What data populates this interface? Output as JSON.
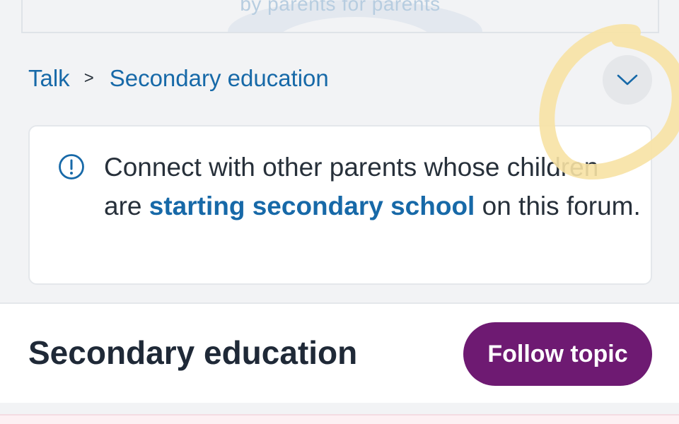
{
  "banner": {
    "tagline": "by parents for parents"
  },
  "breadcrumb": {
    "items": [
      {
        "label": "Talk"
      },
      {
        "label": "Secondary education"
      }
    ],
    "separator": ">"
  },
  "expand_button": {
    "icon": "chevron-down-icon"
  },
  "info": {
    "icon": "info-circle-icon",
    "text_before": "Connect with other parents whose children are ",
    "link_text": "starting secondary school",
    "text_after": " on this forum."
  },
  "topic": {
    "title": "Secondary education",
    "follow_label": "Follow topic"
  },
  "colors": {
    "link": "#1769a8",
    "follow_button": "#6e1a72",
    "annotation": "#f7e2a4",
    "text": "#27303a"
  }
}
